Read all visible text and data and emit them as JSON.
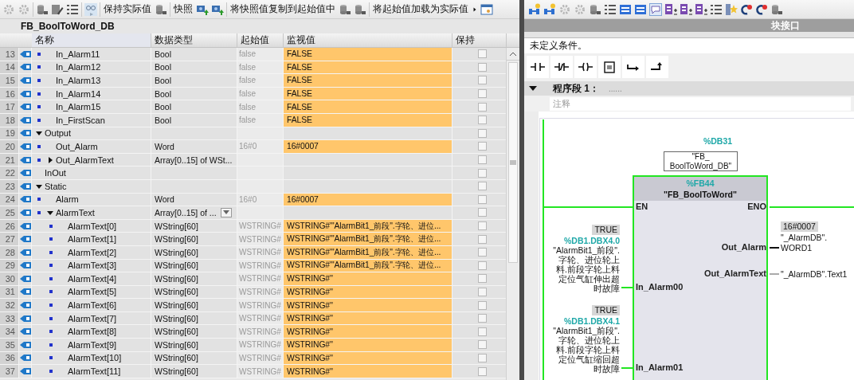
{
  "db_editor": {
    "toolbar_buttons": [
      "保持实际值",
      "快照",
      "将快照值复制到起始值中",
      "将起始值加载为实际值"
    ],
    "title": "FB_BoolToWord_DB",
    "columns": [
      "名称",
      "数据类型",
      "起始值",
      "监视值",
      "保持"
    ],
    "rows": [
      {
        "kind": "section",
        "children": [
          {
            "kind": "member",
            "number": "13",
            "name": "In_Alarm11",
            "data_type": "Bool",
            "start_value": "false",
            "monitor_value": "FALSE",
            "retain": false
          },
          {
            "kind": "member",
            "number": "14",
            "name": "In_Alarm12",
            "data_type": "Bool",
            "start_value": "false",
            "monitor_value": "FALSE",
            "retain": false
          },
          {
            "kind": "member",
            "number": "15",
            "name": "In_Alarm13",
            "data_type": "Bool",
            "start_value": "false",
            "monitor_value": "FALSE",
            "retain": false
          },
          {
            "kind": "member",
            "number": "16",
            "name": "In_Alarm14",
            "data_type": "Bool",
            "start_value": "false",
            "monitor_value": "FALSE",
            "retain": false
          },
          {
            "kind": "member",
            "number": "17",
            "name": "In_Alarm15",
            "data_type": "Bool",
            "start_value": "false",
            "monitor_value": "FALSE",
            "retain": false
          },
          {
            "kind": "member",
            "number": "18",
            "name": "In_FirstScan",
            "data_type": "Bool",
            "start_value": "false",
            "monitor_value": "FALSE",
            "retain": false
          }
        ]
      },
      {
        "kind": "section",
        "number": "19",
        "name": "Output",
        "expanded": true,
        "retain": false,
        "children": [
          {
            "kind": "member",
            "number": "20",
            "name": "Out_Alarm",
            "data_type": "Word",
            "start_value": "16#0",
            "monitor_value": "16#0007",
            "retain": false
          },
          {
            "kind": "member",
            "number": "21",
            "name": "Out_AlarmText",
            "expanded": false,
            "data_type": "Array[0..15] of WSt...",
            "retain": false
          }
        ]
      },
      {
        "kind": "section",
        "number": "22",
        "name": "InOut",
        "retain": false
      },
      {
        "kind": "section",
        "number": "23",
        "name": "Static",
        "expanded": true,
        "retain": false,
        "children": [
          {
            "kind": "member",
            "number": "24",
            "name": "Alarm",
            "data_type": "Word",
            "start_value": "16#0",
            "monitor_value": "16#0007",
            "retain": false
          },
          {
            "kind": "member",
            "number": "25",
            "name": "AlarmText",
            "expanded": true,
            "editing": true,
            "data_type": "Array[0..15] of ...",
            "retain": false,
            "children": [
              {
                "kind": "member",
                "number": "26",
                "name": "AlarmText[0]",
                "data_type": "WString[60]",
                "start_value": "WSTRING#",
                "monitor_value": "WSTRING#'\"AlarmBit1_前段\".字轮、进位...",
                "retain": false
              },
              {
                "kind": "member",
                "number": "27",
                "name": "AlarmText[1]",
                "data_type": "WString[60]",
                "start_value": "WSTRING#",
                "monitor_value": "WSTRING#'\"AlarmBit1_前段\".字轮、进位...",
                "retain": false
              },
              {
                "kind": "member",
                "number": "28",
                "name": "AlarmText[2]",
                "data_type": "WString[60]",
                "start_value": "WSTRING#",
                "monitor_value": "WSTRING#'\"AlarmBit1_前段\".字轮、进位...",
                "retain": false
              },
              {
                "kind": "member",
                "number": "29",
                "name": "AlarmText[3]",
                "data_type": "WString[60]",
                "start_value": "WSTRING#",
                "monitor_value": "WSTRING#'\"AlarmBit1_前段\".字轮、进位...",
                "retain": false
              },
              {
                "kind": "member",
                "number": "30",
                "name": "AlarmText[4]",
                "data_type": "WString[60]",
                "start_value": "WSTRING#",
                "monitor_value": "WSTRING#''",
                "retain": false
              },
              {
                "kind": "member",
                "number": "31",
                "name": "AlarmText[5]",
                "data_type": "WString[60]",
                "start_value": "WSTRING#",
                "monitor_value": "WSTRING#''",
                "retain": false
              },
              {
                "kind": "member",
                "number": "32",
                "name": "AlarmText[6]",
                "data_type": "WString[60]",
                "start_value": "WSTRING#",
                "monitor_value": "WSTRING#''",
                "retain": false
              },
              {
                "kind": "member",
                "number": "33",
                "name": "AlarmText[7]",
                "data_type": "WString[60]",
                "start_value": "WSTRING#",
                "monitor_value": "WSTRING#''",
                "retain": false
              },
              {
                "kind": "member",
                "number": "34",
                "name": "AlarmText[8]",
                "data_type": "WString[60]",
                "start_value": "WSTRING#",
                "monitor_value": "WSTRING#''",
                "retain": false
              },
              {
                "kind": "member",
                "number": "35",
                "name": "AlarmText[9]",
                "data_type": "WString[60]",
                "start_value": "WSTRING#",
                "monitor_value": "WSTRING#''",
                "retain": false
              },
              {
                "kind": "member",
                "number": "36",
                "name": "AlarmText[10]",
                "data_type": "WString[60]",
                "start_value": "WSTRING#",
                "monitor_value": "WSTRING#''",
                "retain": false
              },
              {
                "kind": "member",
                "number": "37",
                "name": "AlarmText[11]",
                "data_type": "WString[60]",
                "start_value": "WSTRING#",
                "monitor_value": "WSTRING#''",
                "retain": false
              }
            ]
          }
        ]
      }
    ]
  },
  "ladder_editor": {
    "panel_title": "块接口",
    "condition": "未定义条件。",
    "network": {
      "title": "程序段 1：",
      "expanded": true,
      "title_placeholder": "......",
      "comment_placeholder": "注释",
      "instance_db": {
        "address": "%DB31",
        "name": "\"FB_\nBoolToWord_DB\""
      },
      "block": {
        "address": "%FB44",
        "name": "\"FB_BoolToWord\"",
        "inputs": [
          {
            "pin": "EN",
            "kind": "bool",
            "powered": true
          },
          {
            "pin": "In_Alarm00",
            "kind": "bool",
            "powered": true,
            "value": "TRUE",
            "address": "%DB1.DBX4.0",
            "operand": "\"AlarmBit1_前段\".字轮、进位轮上料.前段字轮上料定位气缸伸出超时故障"
          },
          {
            "pin": "In_Alarm01",
            "kind": "bool",
            "powered": true,
            "value": "TRUE",
            "address": "%DB1.DBX4.1",
            "operand": "\"AlarmBit1_前段\".字轮、进位轮上料.前段字轮上料定位气缸缩回超时故障"
          }
        ],
        "outputs": [
          {
            "pin": "ENO",
            "kind": "bool",
            "powered": true
          },
          {
            "pin": "Out_Alarm",
            "kind": "word",
            "value": "16#0007",
            "operand": "\"_AlarmDB\".\nWORD1"
          },
          {
            "pin": "Out_AlarmText",
            "kind": "string",
            "operand": "\"_AlarmDB\".Text1"
          }
        ]
      }
    }
  }
}
